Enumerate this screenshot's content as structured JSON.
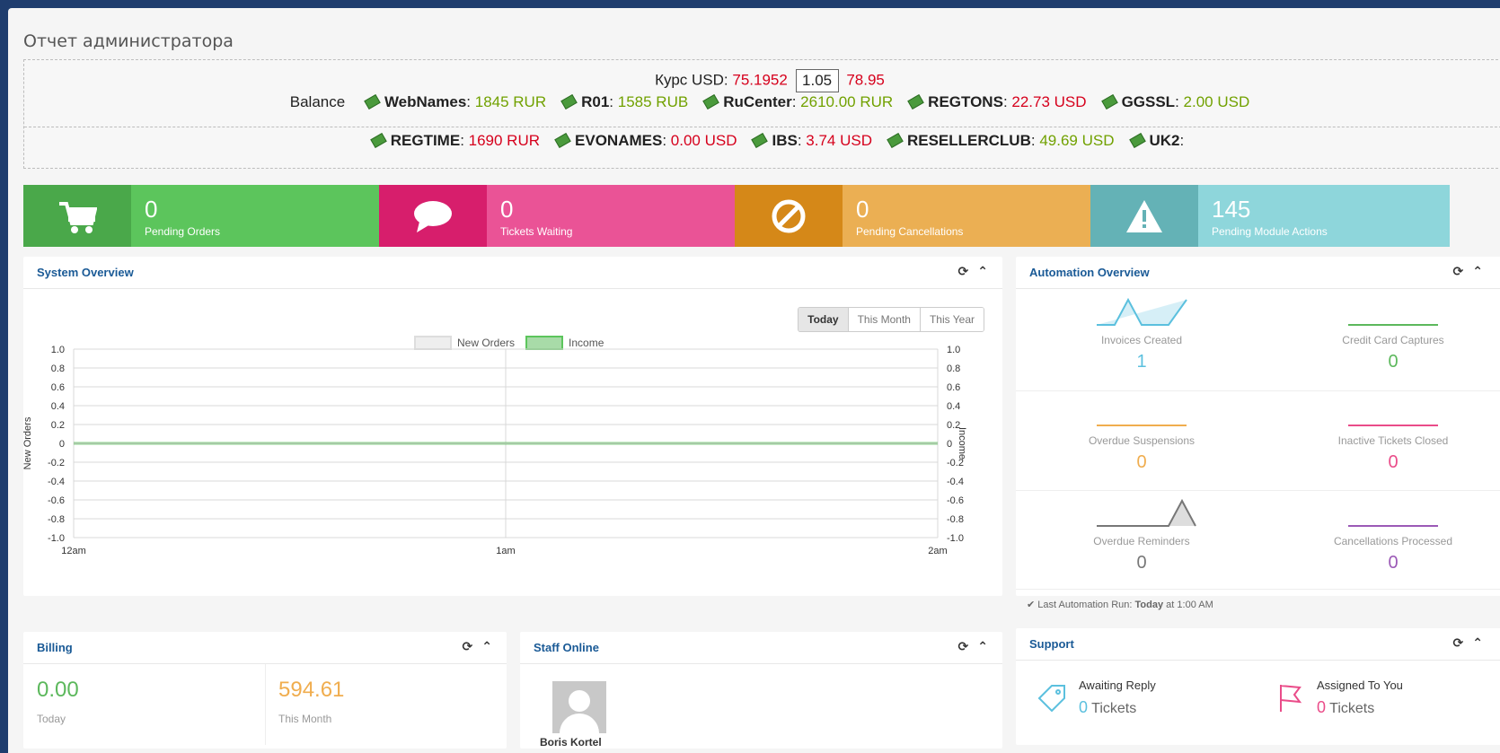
{
  "page": {
    "title": "Отчет администратора"
  },
  "rates": {
    "label": "Курс USD:",
    "base": "75.1952",
    "multiplier": "1.05",
    "result": "78.95",
    "balance_label": "Balance",
    "row1": [
      {
        "name": "WebNames",
        "value": "1845 RUR",
        "color": "#71a100"
      },
      {
        "name": "R01",
        "value": "1585 RUB",
        "color": "#71a100"
      },
      {
        "name": "RuCenter",
        "value": "2610.00 RUR",
        "color": "#71a100"
      },
      {
        "name": "REGTONS",
        "value": "22.73 USD",
        "color": "#d6001c"
      },
      {
        "name": "GGSSL",
        "value": "2.00 USD",
        "color": "#71a100"
      }
    ],
    "row2": [
      {
        "name": "REGTIME",
        "value": "1690 RUR",
        "color": "#d6001c"
      },
      {
        "name": "EVONAMES",
        "value": "0.00 USD",
        "color": "#d6001c"
      },
      {
        "name": "IBS",
        "value": "3.74 USD",
        "color": "#d6001c"
      },
      {
        "name": "RESELLERCLUB",
        "value": "49.69 USD",
        "color": "#71a100"
      },
      {
        "name": "UK2",
        "value": "",
        "color": "#222222"
      }
    ]
  },
  "stats": [
    {
      "count": "0",
      "label": "Pending Orders",
      "icon": "cart-icon",
      "color": "#5cc55c",
      "dark": "#4aa84a"
    },
    {
      "count": "0",
      "label": "Tickets Waiting",
      "icon": "chat-icon",
      "color": "#ea5396",
      "dark": "#d71e6c"
    },
    {
      "count": "0",
      "label": "Pending Cancellations",
      "icon": "ban-icon",
      "color": "#ebaf53",
      "dark": "#d58818"
    },
    {
      "count": "145",
      "label": "Pending Module Actions",
      "icon": "warning-icon",
      "color": "#8ed6db",
      "dark": "#64b2b6"
    }
  ],
  "system_overview": {
    "title": "System Overview",
    "buttons": [
      "Today",
      "This Month",
      "This Year"
    ],
    "legend": [
      "New Orders",
      "Income"
    ]
  },
  "chart_data": {
    "type": "line",
    "x": [
      "12am",
      "1am",
      "2am"
    ],
    "series": [
      {
        "name": "New Orders",
        "values": [
          0,
          0,
          0
        ]
      },
      {
        "name": "Income",
        "values": [
          0,
          0,
          0
        ]
      }
    ],
    "ylabel": "New Orders",
    "y2label": "Income",
    "ylim": [
      -1.0,
      1.0
    ],
    "yticks": [
      "1.0",
      "0.8",
      "0.6",
      "0.4",
      "0.2",
      "0",
      "-0.2",
      "-0.4",
      "-0.6",
      "-0.8",
      "-1.0"
    ],
    "grid": true,
    "legend": "top-center"
  },
  "automation": {
    "title": "Automation Overview",
    "items": [
      {
        "name": "Invoices Created",
        "value": "1",
        "color": "#5bc0de"
      },
      {
        "name": "Credit Card Captures",
        "value": "0",
        "color": "#5cb85c"
      },
      {
        "name": "Overdue Suspensions",
        "value": "0",
        "color": "#f0ad4e"
      },
      {
        "name": "Inactive Tickets Closed",
        "value": "0",
        "color": "#ea4c89"
      },
      {
        "name": "Overdue Reminders",
        "value": "0",
        "color": "#777777"
      },
      {
        "name": "Cancellations Processed",
        "value": "0",
        "color": "#9b59b6"
      }
    ],
    "last_run_prefix": "Last Automation Run:",
    "last_run_day": "Today",
    "last_run_suffix": "at 1:00 AM"
  },
  "billing": {
    "title": "Billing",
    "today_value": "0.00",
    "today_label": "Today",
    "month_value": "594.61",
    "month_label": "This Month"
  },
  "staff": {
    "title": "Staff Online",
    "name": "Boris Kortel"
  },
  "support": {
    "title": "Support",
    "awaiting_title": "Awaiting Reply",
    "awaiting_count": "0",
    "awaiting_unit": "Tickets",
    "assigned_title": "Assigned To You",
    "assigned_count": "0",
    "assigned_unit": "Tickets"
  }
}
